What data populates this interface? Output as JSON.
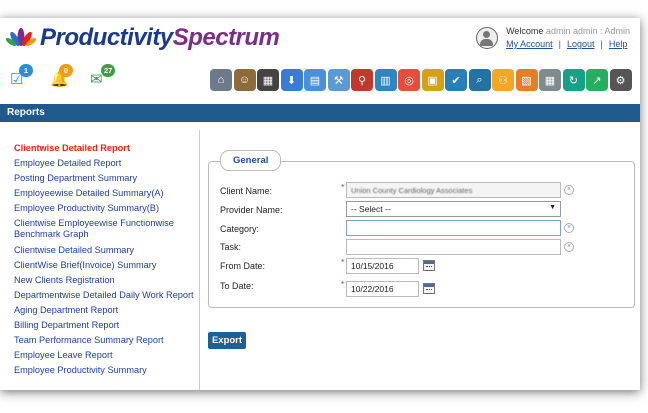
{
  "brand": {
    "part1": "Productivity",
    "part2": "Spectrum"
  },
  "user": {
    "welcome": "Welcome",
    "name": "admin admin : Admin",
    "my_account": "My Account",
    "logout": "Logout",
    "help": "Help"
  },
  "notifications": [
    {
      "icon": "checkbox-icon",
      "count": "1",
      "color": "#2a8fd8"
    },
    {
      "icon": "bell-icon",
      "count": "0",
      "color": "#f39c12"
    },
    {
      "icon": "mail-icon",
      "count": "27",
      "color": "#3aa046"
    }
  ],
  "toolbar": [
    {
      "icon": "home-icon",
      "color": "#6c7a89"
    },
    {
      "icon": "users-icon",
      "color": "#8e6b3d"
    },
    {
      "icon": "team-icon",
      "color": "#444444"
    },
    {
      "icon": "download-icon",
      "color": "#3a7bd5"
    },
    {
      "icon": "folder-icon",
      "color": "#4a90d9"
    },
    {
      "icon": "hammer-icon",
      "color": "#5b9bd5"
    },
    {
      "icon": "search-magnify-icon",
      "color": "#c0392b"
    },
    {
      "icon": "book-icon",
      "color": "#2e86c1"
    },
    {
      "icon": "target-icon",
      "color": "#e74c3c"
    },
    {
      "icon": "box-icon",
      "color": "#d4a017"
    },
    {
      "icon": "checkmark-icon",
      "color": "#2980b9"
    },
    {
      "icon": "chart-search-icon",
      "color": "#2471a3"
    },
    {
      "icon": "org-chart-icon",
      "color": "#f5a623"
    },
    {
      "icon": "presentation-icon",
      "color": "#e67e22"
    },
    {
      "icon": "calculator-icon",
      "color": "#7f8c8d"
    },
    {
      "icon": "clock-refresh-icon",
      "color": "#16a085"
    },
    {
      "icon": "trend-chart-icon",
      "color": "#27ae60"
    },
    {
      "icon": "settings-gear-icon",
      "color": "#555555"
    }
  ],
  "page_title": "Reports",
  "sidebar_items": [
    "Clientwise Detailed Report",
    "Employee Detailed Report",
    "Posting Department Summary",
    "Employeewise Detailed Summary(A)",
    "Employee Productivity Summary(B)",
    "Clientwise Employeewise Functionwise Benchmark Graph",
    "Clientwise Detailed Summary",
    "ClientWise Brief(Invoice) Summary",
    "New Clients Registration",
    "Departmentwise Detailed Daily Work Report",
    "Aging Department Report",
    "Billing Department Report",
    "Team Performance Summary Report",
    "Employee Leave Report",
    "Employee Productivity Summary"
  ],
  "form": {
    "legend": "General",
    "client_label": "Client Name:",
    "client_value": "Union County Cardiology Associates",
    "provider_label": "Provider Name:",
    "provider_value": "-- Select --",
    "category_label": "Category:",
    "category_value": "",
    "task_label": "Task:",
    "task_value": "",
    "from_label": "From Date:",
    "from_value": "10/15/2016",
    "to_label": "To Date:",
    "to_value": "10/22/2016",
    "required_mark": "*",
    "clear_mark": "×"
  },
  "export_label": "Export"
}
